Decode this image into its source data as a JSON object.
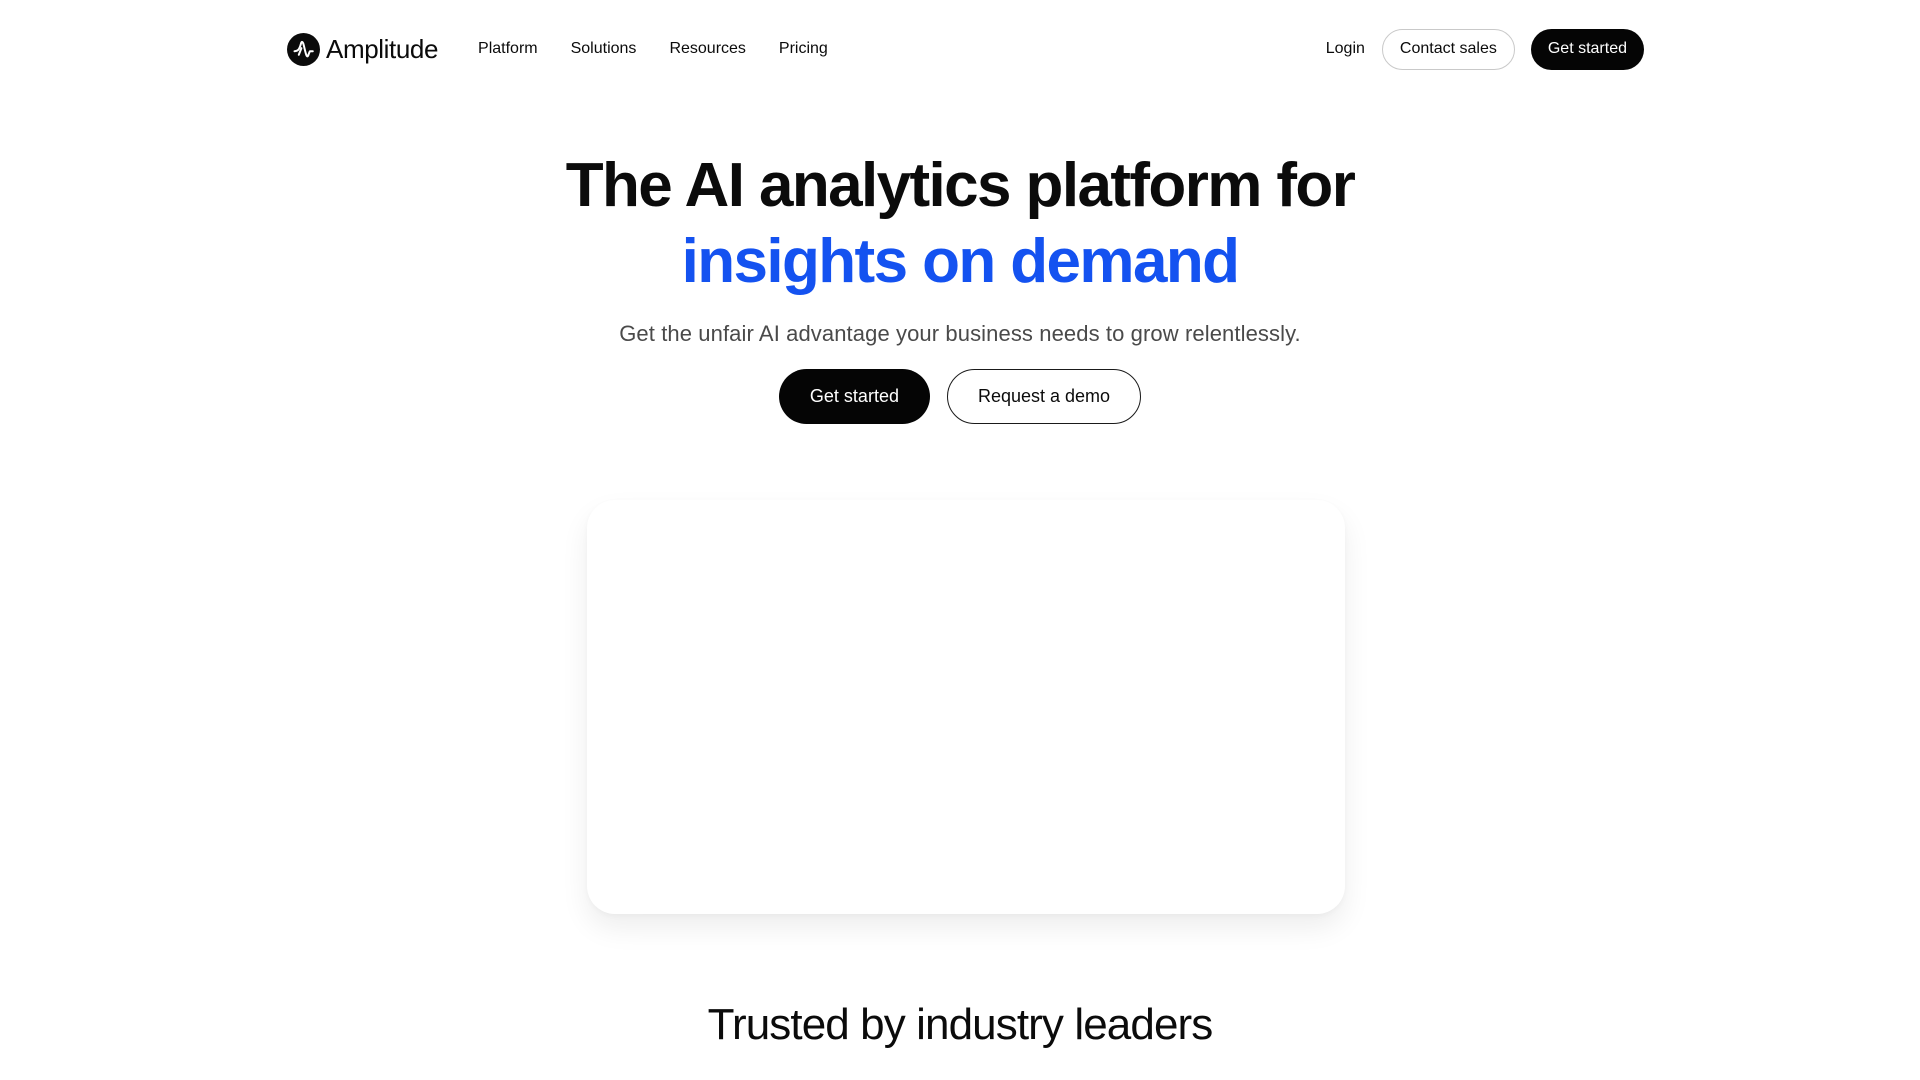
{
  "brand": {
    "name": "Amplitude",
    "logo_icon": "amplitude-logo-icon"
  },
  "nav": {
    "items": [
      {
        "label": "Platform"
      },
      {
        "label": "Solutions"
      },
      {
        "label": "Resources"
      },
      {
        "label": "Pricing"
      }
    ],
    "login_label": "Login",
    "contact_label": "Contact sales",
    "get_started_label": "Get started"
  },
  "hero": {
    "title_line1": "The AI analytics platform for",
    "title_line2": "insights on demand",
    "subtitle": "Get the unfair AI advantage your business needs to grow relentlessly.",
    "primary_cta": "Get started",
    "secondary_cta": "Request a demo"
  },
  "trusted": {
    "heading": "Trusted by industry leaders"
  },
  "colors": {
    "accent": "#1452f0",
    "dark": "#050505",
    "text": "#0b0b0b",
    "muted": "#4a4a4a"
  }
}
